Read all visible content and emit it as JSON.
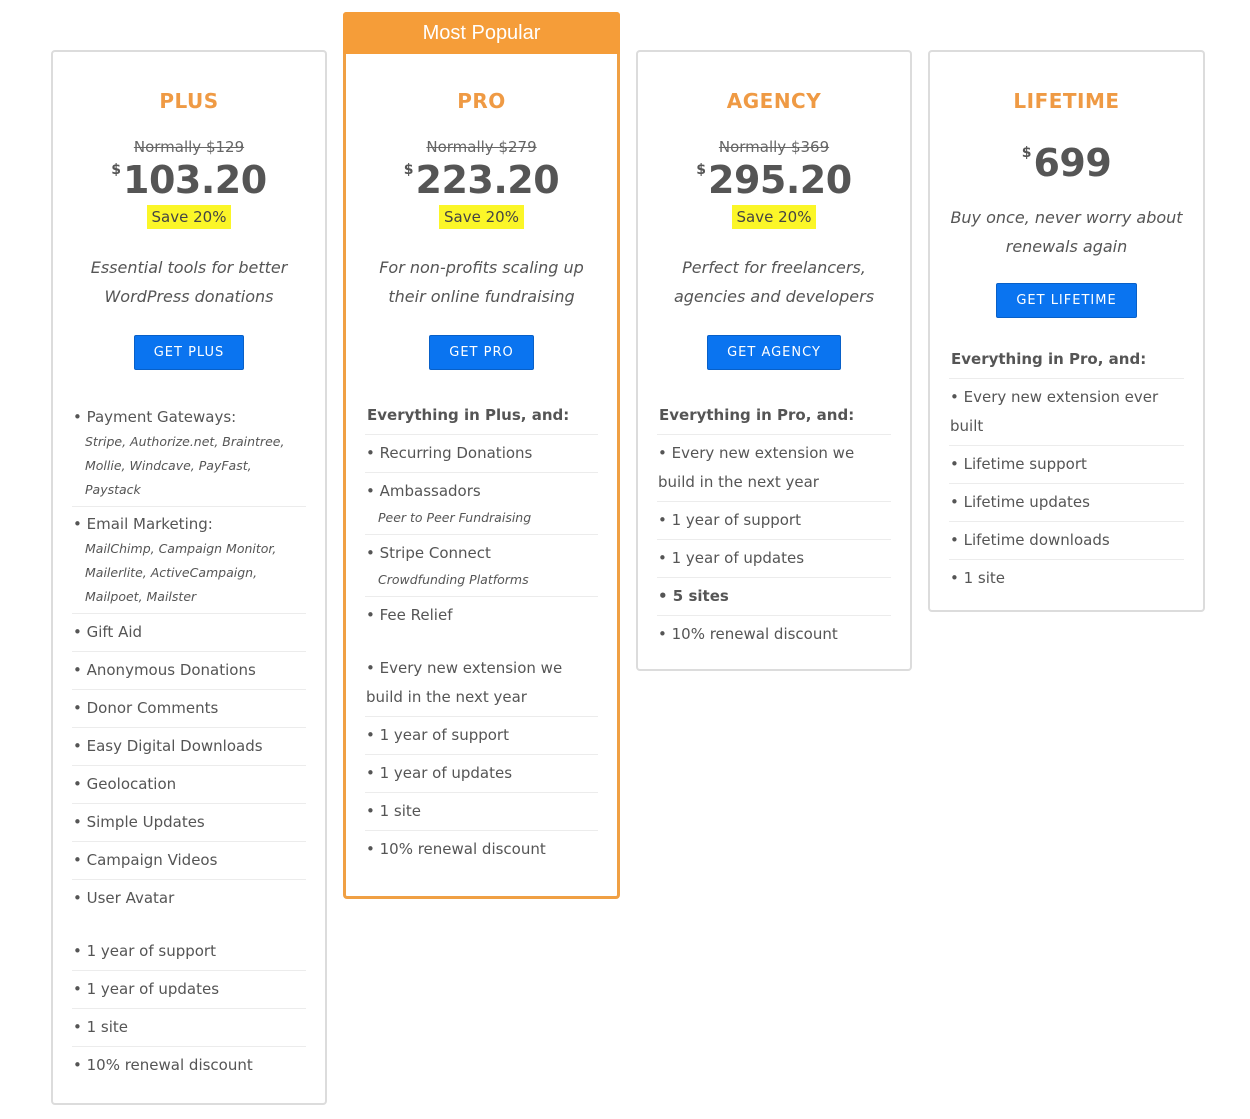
{
  "plans": [
    {
      "id": "plus",
      "name": "PLUS",
      "normally": "Normally $129",
      "currency": "$",
      "price": "103.20",
      "save": "Save 20%",
      "tagline": "Essential tools for better WordPress donations",
      "button": "GET PLUS",
      "features_head": "",
      "features": [
        {
          "text": "• Payment Gateways:",
          "sub": "Stripe, Authorize.net, Braintree, Mollie, Windcave, PayFast, Paystack"
        },
        {
          "text": "• Email Marketing:",
          "sub": "MailChimp, Campaign Monitor, Mailerlite, ActiveCampaign, Mailpoet, Mailster"
        },
        {
          "text": "• Gift Aid"
        },
        {
          "text": "• Anonymous Donations"
        },
        {
          "text": "• Donor Comments"
        },
        {
          "text": "• Easy Digital Downloads"
        },
        {
          "text": "• Geolocation"
        },
        {
          "text": "• Simple Updates"
        },
        {
          "text": "• Campaign Videos"
        },
        {
          "text": "• User Avatar"
        },
        {
          "text": "• 1 year of support"
        },
        {
          "text": "• 1 year of updates"
        },
        {
          "text": "• 1 site"
        },
        {
          "text": "• 10% renewal discount"
        }
      ]
    },
    {
      "id": "pro",
      "badge": "Most Popular",
      "name": "PRO",
      "normally": "Normally $279",
      "currency": "$",
      "price": "223.20",
      "save": "Save 20%",
      "tagline": "For non-profits scaling up their online fundraising",
      "button": "GET PRO",
      "features_head": "Everything in Plus, and:",
      "features": [
        {
          "text": "• Recurring Donations"
        },
        {
          "text": "• Ambassadors",
          "sub": "Peer to Peer Fundraising"
        },
        {
          "text": "• Stripe Connect",
          "sub": "Crowdfunding Platforms"
        },
        {
          "text": "• Fee Relief"
        },
        {
          "text": "• Every new extension we build in the next year"
        },
        {
          "text": "• 1 year of support"
        },
        {
          "text": "• 1 year of updates"
        },
        {
          "text": "• 1 site"
        },
        {
          "text": "• 10% renewal discount"
        }
      ]
    },
    {
      "id": "agency",
      "name": "AGENCY",
      "normally": "Normally $369",
      "currency": "$",
      "price": "295.20",
      "save": "Save 20%",
      "tagline": "Perfect for freelancers, agencies and developers",
      "button": "GET AGENCY",
      "features_head": "Everything in Pro, and:",
      "features": [
        {
          "text": "• Every new extension we build in the next year"
        },
        {
          "text": "• 1 year of support"
        },
        {
          "text": "• 1 year of updates"
        },
        {
          "text": "• 5 sites"
        },
        {
          "text": "• 10% renewal discount"
        }
      ]
    },
    {
      "id": "lifetime",
      "name": "LIFETIME",
      "currency": "$",
      "price": "699",
      "tagline": "Buy once, never worry about renewals again",
      "button": "GET LIFETIME",
      "features_head": "Everything in Pro, and:",
      "features": [
        {
          "text": "• Every new extension ever built"
        },
        {
          "text": "• Lifetime support"
        },
        {
          "text": "• Lifetime updates"
        },
        {
          "text": "• Lifetime downloads"
        },
        {
          "text": "• 1 site"
        }
      ]
    }
  ],
  "colors": {
    "accent_orange": "#ef9a44",
    "ribbon_orange": "#f59d39",
    "button_blue": "#0a74f0",
    "save_highlight": "#fbf628",
    "text_gray": "#555555"
  }
}
